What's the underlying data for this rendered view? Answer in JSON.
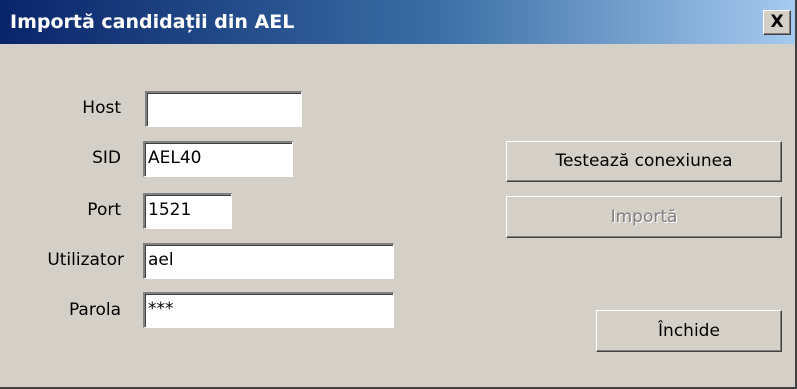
{
  "window": {
    "title": "Importă candidații din AEL",
    "close_label": "X"
  },
  "form": {
    "host": {
      "label": "Host",
      "value": ""
    },
    "sid": {
      "label": "SID",
      "value": "AEL40"
    },
    "port": {
      "label": "Port",
      "value": "1521"
    },
    "user": {
      "label": "Utilizator",
      "value": "ael"
    },
    "password": {
      "label": "Parola",
      "value": "***"
    }
  },
  "buttons": {
    "test_label": "Testează conexiunea",
    "import_label": "Importă",
    "close_label": "Închide"
  },
  "colors": {
    "titlebar_start": "#0a246a",
    "titlebar_end": "#a6caf0",
    "dialog_face": "#d4d0c8",
    "disabled_text": "#808080"
  }
}
